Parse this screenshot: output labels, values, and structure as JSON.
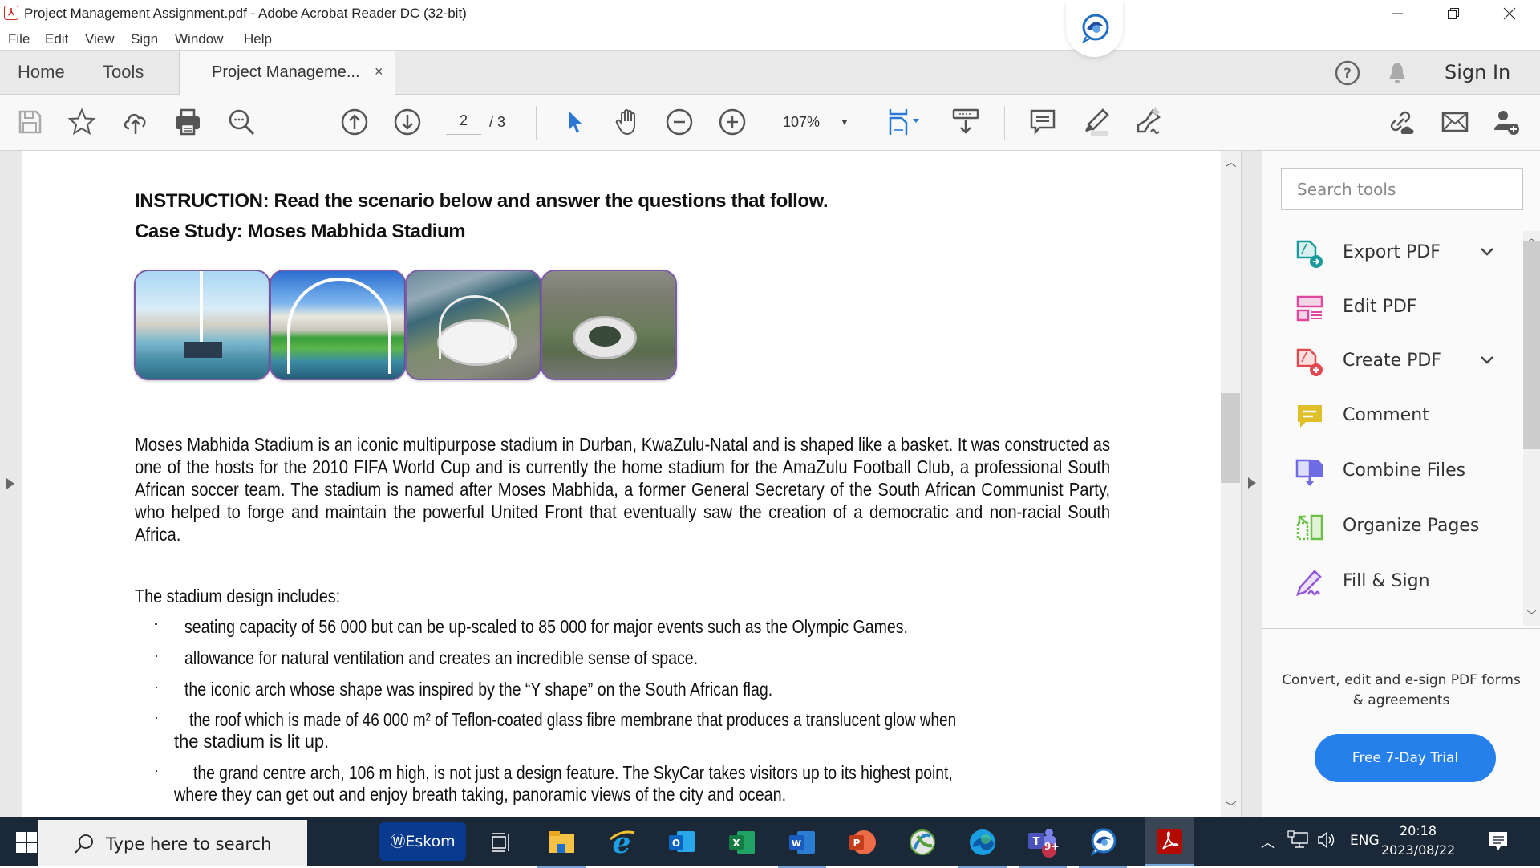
{
  "window": {
    "title": "Project Management Assignment.pdf - Adobe Acrobat Reader DC (32-bit)",
    "app_icon": "acrobat-icon",
    "controls": [
      "minimize",
      "restore",
      "close"
    ]
  },
  "menu": [
    "File",
    "Edit",
    "View",
    "Sign",
    "Window",
    "Help"
  ],
  "tabs": {
    "home": "Home",
    "tools": "Tools",
    "document_tab": "Project Manageme...",
    "close_glyph": "×",
    "sign_in": "Sign In"
  },
  "toolbar": {
    "page_current": "2",
    "page_total": "/ 3",
    "zoom_level": "107%",
    "icons": [
      "save-icon",
      "bookmark-star-icon",
      "upload-cloud-icon",
      "print-icon",
      "search-zoom-icon",
      "previous-page-icon",
      "next-page-icon",
      "select-pointer-icon",
      "hand-icon",
      "zoom-out-icon",
      "zoom-in-icon",
      "fit-page-icon",
      "scroll-mode-icon",
      "comment-icon",
      "highlight-icon",
      "sign-pen-icon",
      "share-link-icon",
      "email-icon",
      "add-user-icon"
    ]
  },
  "document": {
    "instruction": "INSTRUCTION: Read the scenario below and answer the questions that follow.",
    "case_title": "Case Study: Moses Mabhida Stadium",
    "photos": [
      "stadium-interior-arch",
      "stadium-interior-pitch",
      "stadium-aerial-coast",
      "stadium-aerial-city"
    ],
    "paragraph": "Moses Mabhida Stadium is an iconic multipurpose stadium in Durban, KwaZulu-Natal and is shaped like a basket. It was constructed as one of the hosts for the 2010 FIFA World Cup and is currently the home stadium for the AmaZulu Football Club, a professional South African soccer team. The stadium is named after Moses Mabhida, a former General Secretary of the South African Communist Party, who helped to forge and maintain the powerful United Front that eventually saw the creation of a democratic and non-racial South Africa.",
    "design_intro": "The stadium design includes:",
    "bullets": [
      "seating capacity of 56 000 but can be up-scaled to 85 000 for major events such as the Olympic Games.",
      "allowance for natural ventilation and creates an incredible sense of space.",
      "the iconic arch whose shape was inspired by the “Y shape” on the South African flag.",
      "the roof which is made of 46 000 m² of Teflon-coated glass fibre membrane that produces a translucent glow when",
      "the stadium is lit up.",
      "the grand centre arch, 106 m high, is not just a design feature. The SkyCar takes visitors up to its highest point,",
      "where they can get out and enjoy breath taking, panoramic views of the city and ocean."
    ],
    "bullet_glyph": "·"
  },
  "tools_panel": {
    "search_placeholder": "Search tools",
    "items": [
      {
        "label": "Export PDF",
        "icon": "export-pdf-icon",
        "color": "#1a9a9a",
        "expandable": true
      },
      {
        "label": "Edit PDF",
        "icon": "edit-pdf-icon",
        "color": "#e0479e",
        "expandable": false
      },
      {
        "label": "Create PDF",
        "icon": "create-pdf-icon",
        "color": "#e34850",
        "expandable": true
      },
      {
        "label": "Comment",
        "icon": "comment-icon",
        "color": "#e0c02a",
        "expandable": false
      },
      {
        "label": "Combine Files",
        "icon": "combine-files-icon",
        "color": "#6e6be5",
        "expandable": false
      },
      {
        "label": "Organize Pages",
        "icon": "organize-pages-icon",
        "color": "#6cc04a",
        "expandable": false
      },
      {
        "label": "Fill & Sign",
        "icon": "fill-sign-icon",
        "color": "#9256d9",
        "expandable": false
      }
    ],
    "promo_text": "Convert, edit and e-sign PDF forms & agreements",
    "trial_button": "Free 7-Day Trial",
    "accent": "#2680eb"
  },
  "taskbar": {
    "search_placeholder": "Type here to search",
    "eskom_label": "ⓌEskom",
    "apps": [
      "task-view",
      "file-explorer",
      "internet-explorer",
      "outlook",
      "excel",
      "word",
      "powerpoint",
      "cisco-anyconnect",
      "edge",
      "teams",
      "webex",
      "acrobat-reader"
    ],
    "teams_badge": "9+",
    "language": "ENG",
    "time": "20:18",
    "date": "2023/08/22"
  }
}
